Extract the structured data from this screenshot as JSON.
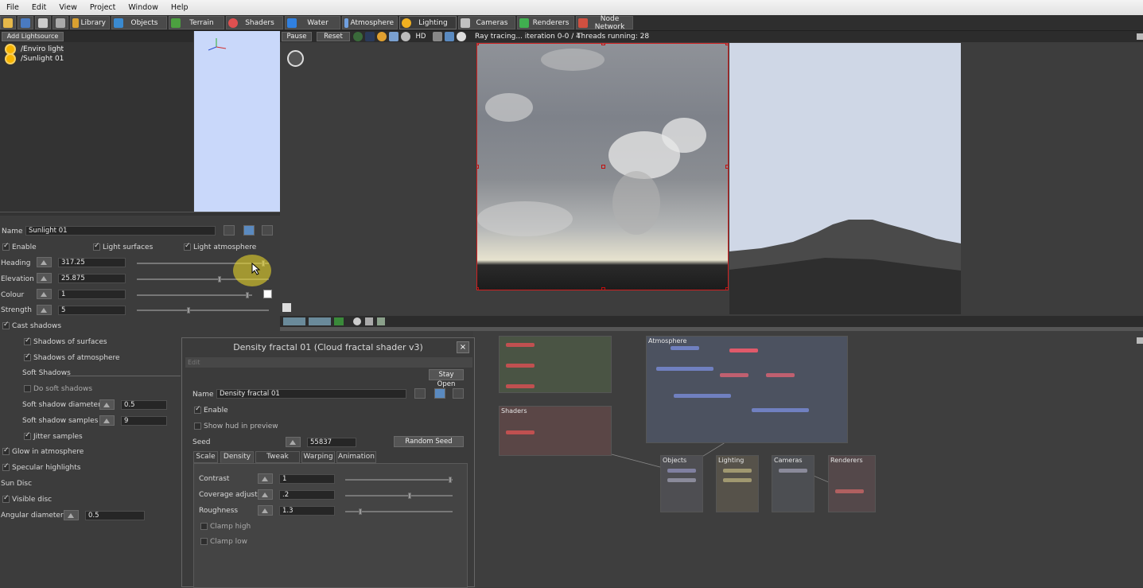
{
  "menu": [
    "File",
    "Edit",
    "View",
    "Project",
    "Window",
    "Help"
  ],
  "toolbar": [
    {
      "label": "Library",
      "color": "#d8a030"
    },
    {
      "label": "Objects",
      "color": "#3a8ad0"
    },
    {
      "label": "Terrain",
      "color": "#4ca040"
    },
    {
      "label": "Shaders",
      "color": "#e05050"
    },
    {
      "label": "Water",
      "color": "#3080e0"
    },
    {
      "label": "Atmosphere",
      "color": "#70a0e0"
    },
    {
      "label": "Lighting",
      "color": "#f0b020"
    },
    {
      "label": "Cameras",
      "color": "#c0c0c0"
    },
    {
      "label": "Renderers",
      "color": "#40b050"
    },
    {
      "label": "Node Network",
      "color": "#d05040"
    }
  ],
  "lightsources": {
    "add_label": "Add Lightsource",
    "items": [
      "/Enviro light",
      "/Sunlight 01"
    ]
  },
  "sun_props": {
    "name_label": "Name",
    "name_value": "Sunlight 01",
    "enable": "Enable",
    "light_surfaces": "Light surfaces",
    "light_atmosphere": "Light atmosphere",
    "heading_label": "Heading",
    "heading_value": "317.25",
    "heading_pos": 0.97,
    "elevation_label": "Elevation",
    "elevation_value": "25.875",
    "elevation_pos": 0.63,
    "colour_label": "Colour",
    "colour_value": "1",
    "colour_pos": 0.97,
    "strength_label": "Strength",
    "strength_value": "5",
    "strength_pos": 0.39,
    "cast_shadows": "Cast shadows",
    "shadows_surfaces": "Shadows of surfaces",
    "shadows_atmosphere": "Shadows of atmosphere",
    "soft_shadows": "Soft Shadows",
    "do_soft": "Do soft shadows",
    "soft_diameter_label": "Soft shadow diameter",
    "soft_diameter_value": "0.5",
    "soft_samples_label": "Soft shadow samples",
    "soft_samples_value": "9",
    "jitter": "Jitter samples",
    "glow": "Glow in atmosphere",
    "specular": "Specular highlights",
    "sun_disc": "Sun Disc",
    "visible_disc": "Visible disc",
    "angular_label": "Angular diameter",
    "angular_value": "0.5"
  },
  "viewport": {
    "pause": "Pause",
    "reset": "Reset",
    "hd": "HD",
    "status": "Ray tracing... iteration 0-0 / 4",
    "threads": "Threads running: 28"
  },
  "nodes": {
    "atmosphere": "Atmosphere",
    "shaders": "Shaders",
    "objects": "Objects",
    "lighting": "Lighting",
    "cameras": "Cameras",
    "renderers": "Renderers"
  },
  "dialog": {
    "title": "Density fractal 01    (Cloud fractal shader v3)",
    "close": "×",
    "edit": "Edit",
    "stay_open": "Stay Open",
    "name_label": "Name",
    "name_value": "Density fractal 01",
    "enable": "Enable",
    "show_hud": "Show hud in preview",
    "seed_label": "Seed",
    "seed_value": "55837",
    "random_seed": "Random Seed",
    "tabs": [
      "Scale",
      "Density",
      "Tweak Noise",
      "Warping",
      "Animation"
    ],
    "contrast_label": "Contrast",
    "contrast_value": "1",
    "contrast_pos": 0.99,
    "coverage_label": "Coverage adjust",
    "coverage_value": ".2",
    "coverage_pos": 0.6,
    "roughness_label": "Roughness",
    "roughness_value": "1.3",
    "roughness_pos": 0.13,
    "clamp_high": "Clamp high",
    "clamp_low": "Clamp low"
  }
}
